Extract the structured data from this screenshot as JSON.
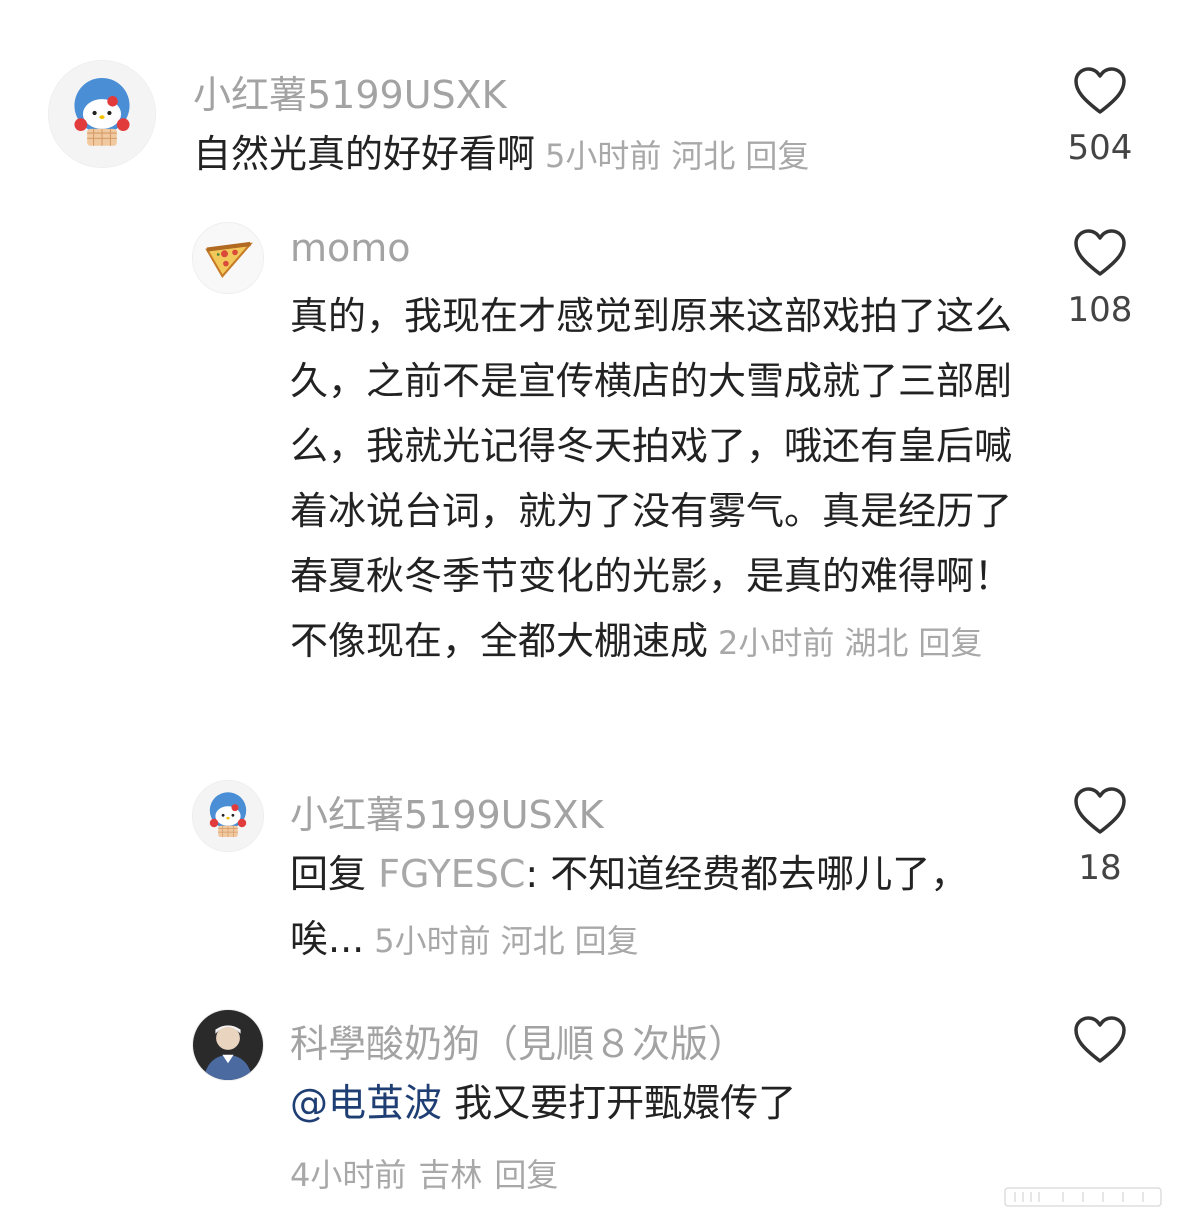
{
  "comments": [
    {
      "username": "小红薯5199USXK",
      "text": "自然光真的好好看啊",
      "time": "5小时前",
      "location": "河北",
      "reply_label": "回复",
      "likes": "504",
      "avatar": "hello-kitty-avatar"
    },
    {
      "username": "momo",
      "text": "真的，我现在才感觉到原来这部戏拍了这么久，之前不是宣传横店的大雪成就了三部剧么，我就光记得冬天拍戏了，哦还有皇后喊着冰说台词，就为了没有雾气。真是经历了春夏秋冬季节变化的光影，是真的难得啊！不像现在，全都大棚速成",
      "time": "2小时前",
      "location": "湖北",
      "reply_label": "回复",
      "likes": "108",
      "avatar": "pizza-avatar"
    },
    {
      "username": "小红薯5199USXK",
      "reply_prefix": "回复",
      "reply_to": "FGYESC",
      "text": ": 不知道经费都去哪儿了，唉...",
      "time": "5小时前",
      "location": "河北",
      "reply_label": "回复",
      "likes": "18",
      "avatar": "hello-kitty-avatar"
    },
    {
      "username": "科學酸奶狗（見順８次版）",
      "mention": "@电茧波",
      "text": "我又要打开甄嬛传了",
      "time": "4小时前",
      "location": "吉林",
      "reply_label": "回复",
      "likes": "",
      "avatar": "person-photo-avatar"
    }
  ]
}
